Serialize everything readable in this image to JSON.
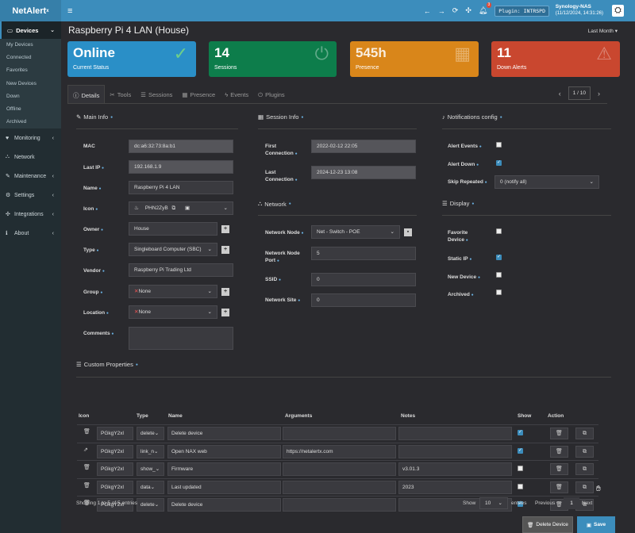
{
  "app": {
    "logo": "NetAlert",
    "logo_sup": "x"
  },
  "topbar": {
    "notif_count": "3",
    "plugin_label": "Plugin: INTRSPD",
    "server_name": "Synology-NAS",
    "server_time": "(11/12/2024, 14:31:26)"
  },
  "sidebar": {
    "devices_label": "Devices",
    "device_subitems": [
      "My Devices",
      "Connected",
      "Favorites",
      "New Devices",
      "Down",
      "Offline",
      "Archived"
    ],
    "items": [
      "Monitoring",
      "Network",
      "Maintenance",
      "Settings",
      "Integrations",
      "About"
    ]
  },
  "page": {
    "title": "Raspberry Pi 4 LAN (House)",
    "period": "Last Month"
  },
  "boxes": [
    {
      "value": "Online",
      "label": "Current Status",
      "color": "#2a8fc7"
    },
    {
      "value": "14",
      "label": "Sessions",
      "color": "#0d7d4b"
    },
    {
      "value": "545h",
      "label": "Presence",
      "color": "#d9861a"
    },
    {
      "value": "11",
      "label": "Down Alerts",
      "color": "#c9472f"
    }
  ],
  "tabs": [
    "Details",
    "Tools",
    "Sessions",
    "Presence",
    "Events",
    "Plugins"
  ],
  "pager": {
    "label": "1 / 10"
  },
  "main_info": {
    "title": "Main Info",
    "mac_label": "MAC",
    "mac": "dc:a6:32:73:8a:b1",
    "lastip_label": "Last IP",
    "lastip": "192.168.1.9",
    "name_label": "Name",
    "name": "Raspberry Pi 4 LAN",
    "icon_label": "Icon",
    "icon": "PHN2ZyB",
    "owner_label": "Owner",
    "owner": "House",
    "type_label": "Type",
    "type": "Singleboard Computer (SBC)",
    "vendor_label": "Vendor",
    "vendor": "Raspberry Pi Trading Ltd",
    "group_label": "Group",
    "group": "None",
    "location_label": "Location",
    "location": "None",
    "comments_label": "Comments",
    "comments": ""
  },
  "session_info": {
    "title": "Session Info",
    "first_label_1": "First",
    "first_label_2": "Connection",
    "first": "2022-02-12   22:05",
    "last_label_1": "Last",
    "last_label_2": "Connection",
    "last": "2024-12-23   13:08"
  },
  "network": {
    "title": "Network",
    "node_label": "Network Node",
    "node": "Net - Switch - POE",
    "port_label_1": "Network Node",
    "port_label_2": "Port",
    "port": "5",
    "ssid_label": "SSID",
    "ssid": "0",
    "site_label": "Network Site",
    "site": "0"
  },
  "notifications": {
    "title": "Notifications config",
    "alert_events_label": "Alert Events",
    "alert_events": false,
    "alert_down_label": "Alert Down",
    "alert_down": true,
    "skip_label": "Skip Repeated",
    "skip": "0 (notify all)"
  },
  "display": {
    "title": "Display",
    "favorite_label_1": "Favorite",
    "favorite_label_2": "Device",
    "favorite": false,
    "static_label": "Static IP",
    "static": true,
    "new_label": "New Device",
    "new": false,
    "archived_label": "Archived",
    "archived": false
  },
  "custom_props": {
    "title": "Custom Properties",
    "headers": [
      "Icon",
      "Type",
      "Name",
      "Arguments",
      "Notes",
      "Show",
      "Action"
    ],
    "rows": [
      {
        "icon": "PGkgY2xl",
        "type": "delete",
        "name": "Delete device",
        "args": "",
        "notes": "",
        "show": true,
        "rowicon": "trash-icon"
      },
      {
        "icon": "PGkgY2xl",
        "type": "link_n",
        "name": "Open NAX web",
        "args": "https://netalertx.com",
        "notes": "",
        "show": true,
        "rowicon": "external-link-icon"
      },
      {
        "icon": "PGkgY2xl",
        "type": "show_",
        "name": "Firmware",
        "args": "",
        "notes": "v3.01.3",
        "show": false,
        "rowicon": "trash-icon"
      },
      {
        "icon": "PGkgY2xl",
        "type": "data",
        "name": "Last updated",
        "args": "",
        "notes": "2023",
        "show": false,
        "rowicon": "trash-icon"
      },
      {
        "icon": "PGkgY2xl",
        "type": "delete",
        "name": "Delete device",
        "args": "",
        "notes": "",
        "show": true,
        "rowicon": "trash-icon"
      }
    ],
    "showing": "Showing 1 to 5 of 5 entries",
    "show_label": "Show",
    "show_count": "10",
    "entries_label": "entries",
    "prev": "Previous",
    "page": "1",
    "next": "Next"
  },
  "actions": {
    "delete": "Delete Device",
    "save": "Save"
  }
}
